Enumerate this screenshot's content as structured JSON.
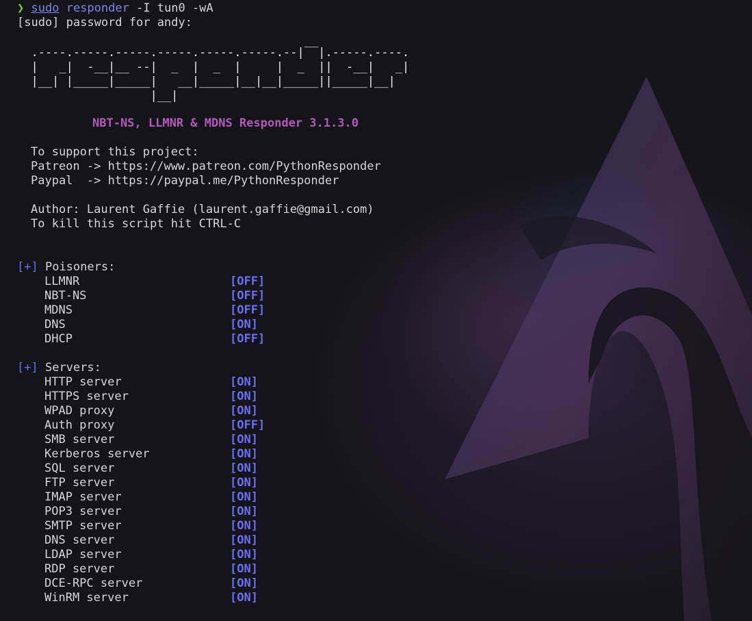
{
  "prompt": {
    "arrow": "❯",
    "sudo": "sudo",
    "cmd": "responder",
    "args": " -I tun0 -wA"
  },
  "sudo_line": "[sudo] password for andy:",
  "ascii_art": [
    "                                         __",
    "  .----.-----.-----.-----.-----.-----.--|  |.-----.----.",
    "  |   _|  -__|__ --|  _  |  _  |     |  _  ||  -__|   _|",
    "  |__| |_____|_____|   __|_____|__|__|_____||_____|__|",
    "                   |__|"
  ],
  "banner": "NBT-NS, LLMNR & MDNS Responder 3.1.3.0",
  "support": {
    "heading": "To support this project:",
    "patreon": "Patreon -> https://www.patreon.com/PythonResponder",
    "paypal": "Paypal  -> https://paypal.me/PythonResponder"
  },
  "author": "Author: Laurent Gaffie (laurent.gaffie@gmail.com)",
  "kill_hint": "To kill this script hit CTRL-C",
  "poisoners": {
    "marker": "[+]",
    "title": "Poisoners:",
    "items": [
      {
        "name": "LLMNR",
        "status": "[OFF]"
      },
      {
        "name": "NBT-NS",
        "status": "[OFF]"
      },
      {
        "name": "MDNS",
        "status": "[OFF]"
      },
      {
        "name": "DNS",
        "status": "[ON]"
      },
      {
        "name": "DHCP",
        "status": "[OFF]"
      }
    ]
  },
  "servers": {
    "marker": "[+]",
    "title": "Servers:",
    "items": [
      {
        "name": "HTTP server",
        "status": "[ON]"
      },
      {
        "name": "HTTPS server",
        "status": "[ON]"
      },
      {
        "name": "WPAD proxy",
        "status": "[ON]"
      },
      {
        "name": "Auth proxy",
        "status": "[OFF]"
      },
      {
        "name": "SMB server",
        "status": "[ON]"
      },
      {
        "name": "Kerberos server",
        "status": "[ON]"
      },
      {
        "name": "SQL server",
        "status": "[ON]"
      },
      {
        "name": "FTP server",
        "status": "[ON]"
      },
      {
        "name": "IMAP server",
        "status": "[ON]"
      },
      {
        "name": "POP3 server",
        "status": "[ON]"
      },
      {
        "name": "SMTP server",
        "status": "[ON]"
      },
      {
        "name": "DNS server",
        "status": "[ON]"
      },
      {
        "name": "LDAP server",
        "status": "[ON]"
      },
      {
        "name": "RDP server",
        "status": "[ON]"
      },
      {
        "name": "DCE-RPC server",
        "status": "[ON]"
      },
      {
        "name": "WinRM server",
        "status": "[ON]"
      }
    ]
  },
  "colors": {
    "background": "#15141b",
    "prompt_arrow": "#7fd23a",
    "command": "#7f84e6",
    "banner": "#b15ab8",
    "status": "#6b6ff0"
  }
}
